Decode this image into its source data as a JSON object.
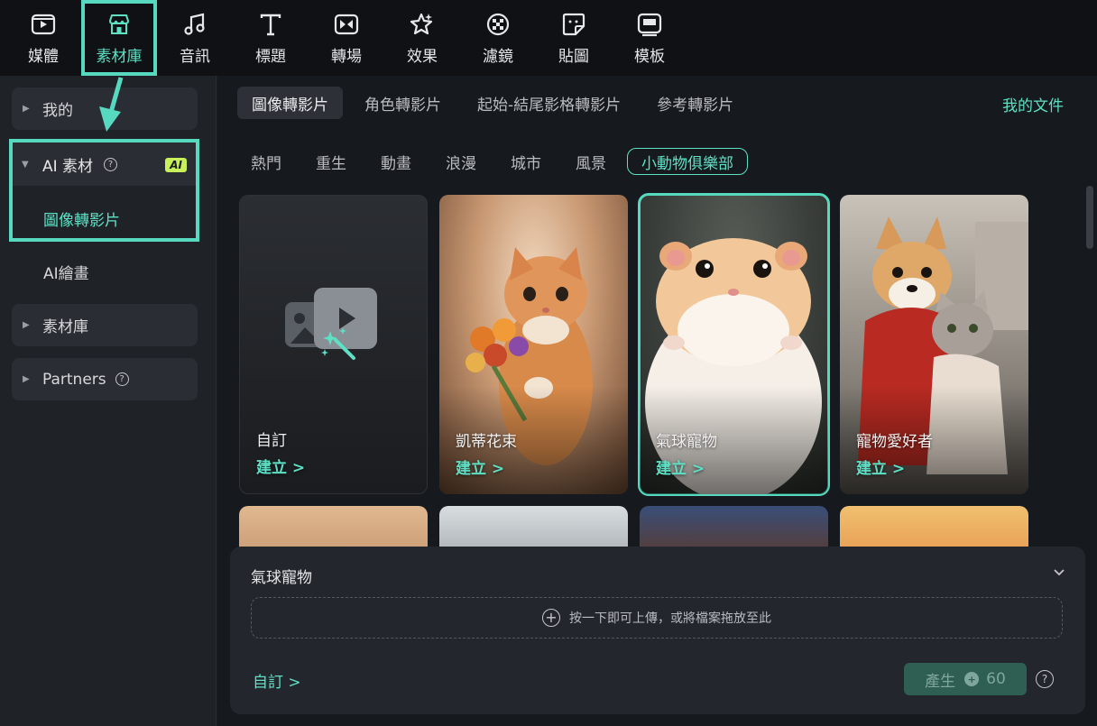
{
  "toolbar": {
    "items": [
      {
        "label": "媒體",
        "icon": "media-icon"
      },
      {
        "label": "素材庫",
        "icon": "store-icon"
      },
      {
        "label": "音訊",
        "icon": "music-note-icon"
      },
      {
        "label": "標題",
        "icon": "text-t-icon"
      },
      {
        "label": "轉場",
        "icon": "transition-icon"
      },
      {
        "label": "效果",
        "icon": "sparkle-effect-icon"
      },
      {
        "label": "濾鏡",
        "icon": "filter-icon"
      },
      {
        "label": "貼圖",
        "icon": "sticker-icon"
      },
      {
        "label": "模板",
        "icon": "template-icon"
      }
    ],
    "active_index": 1
  },
  "sidebar": {
    "my": "我的",
    "ai_materials": "AI 素材",
    "ai_badge": "AI",
    "image_to_video": "圖像轉影片",
    "ai_drawing": "AI繪畫",
    "library": "素材庫",
    "partners": "Partners"
  },
  "tabs": [
    "圖像轉影片",
    "角色轉影片",
    "起始-結尾影格轉影片",
    "參考轉影片"
  ],
  "my_docs": "我的文件",
  "categories": [
    "熱門",
    "重生",
    "動畫",
    "浪漫",
    "城市",
    "風景",
    "小動物俱樂部"
  ],
  "cards": [
    {
      "title": "自訂",
      "cta": "建立 >"
    },
    {
      "title": "凱蒂花束",
      "cta": "建立 >"
    },
    {
      "title": "氣球寵物",
      "cta": "建立 >"
    },
    {
      "title": "寵物愛好者",
      "cta": "建立 >"
    }
  ],
  "panel": {
    "title": "氣球寵物",
    "upload_hint": "按一下即可上傳，或將檔案拖放至此",
    "custom_link": "自訂 >",
    "generate_label": "產生",
    "credits": "60"
  },
  "colors": {
    "accent": "#57d9bf",
    "badge": "#c8f05a"
  }
}
